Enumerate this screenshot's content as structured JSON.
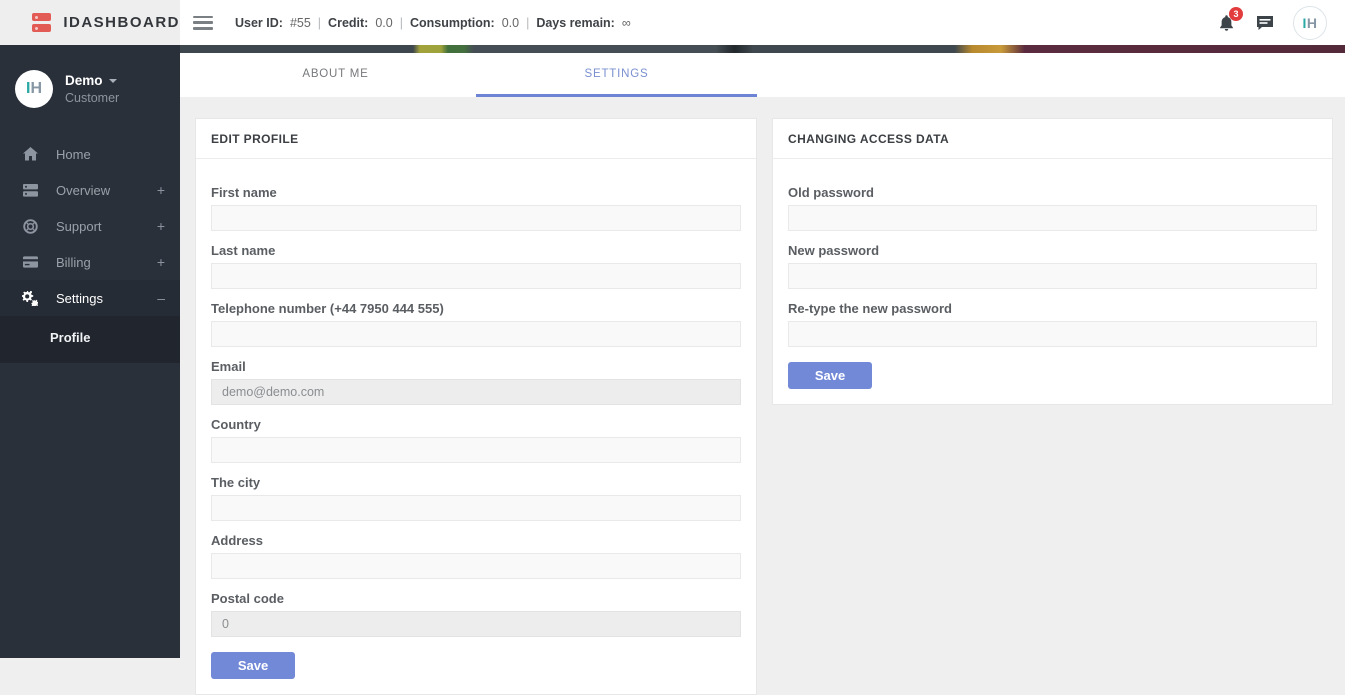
{
  "brand": {
    "name": "IDASHBOARD"
  },
  "topbar": {
    "separator": "|",
    "stats": [
      {
        "label": "User ID:",
        "value": "#55"
      },
      {
        "label": "Credit:",
        "value": "0.0"
      },
      {
        "label": "Consumption:",
        "value": "0.0"
      },
      {
        "label": "Days remain:",
        "value": "∞"
      }
    ],
    "notifications_count": "3",
    "avatar": {
      "letter_i": "I",
      "letter_h": "H"
    }
  },
  "sidebar": {
    "user": {
      "name": "Demo",
      "role": "Customer",
      "avatar_i": "I",
      "avatar_h": "H"
    },
    "items": [
      {
        "label": "Home",
        "suffix": ""
      },
      {
        "label": "Overview",
        "suffix": "+"
      },
      {
        "label": "Support",
        "suffix": "+"
      },
      {
        "label": "Billing",
        "suffix": "+"
      },
      {
        "label": "Settings",
        "suffix": "–"
      }
    ],
    "subitems": [
      {
        "label": "Profile"
      }
    ]
  },
  "tabs": [
    {
      "label": "ABOUT ME"
    },
    {
      "label": "SETTINGS"
    }
  ],
  "edit_profile": {
    "title": "EDIT PROFILE",
    "fields": [
      {
        "label": "First name",
        "value": ""
      },
      {
        "label": "Last name",
        "value": ""
      },
      {
        "label": "Telephone number (+44 7950 444 555)",
        "value": ""
      },
      {
        "label": "Email",
        "value": "demo@demo.com"
      },
      {
        "label": "Country",
        "value": ""
      },
      {
        "label": "The city",
        "value": ""
      },
      {
        "label": "Address",
        "value": ""
      },
      {
        "label": "Postal code",
        "value": "0"
      }
    ],
    "save_label": "Save"
  },
  "access_data": {
    "title": "CHANGING ACCESS DATA",
    "fields": [
      {
        "label": "Old password",
        "value": ""
      },
      {
        "label": "New password",
        "value": ""
      },
      {
        "label": "Re-type the new password",
        "value": ""
      }
    ],
    "save_label": "Save"
  },
  "colors": {
    "accent": "#7289d8",
    "brand_red": "#e25b55",
    "logo_teal": "#2aa9a5",
    "logo_slate": "#8796a4",
    "sidebar_bg": "#2a303a",
    "sidebar_active_bg": "#21262e",
    "badge_red": "#e23c3c",
    "tab_active": "#6d84d4"
  }
}
